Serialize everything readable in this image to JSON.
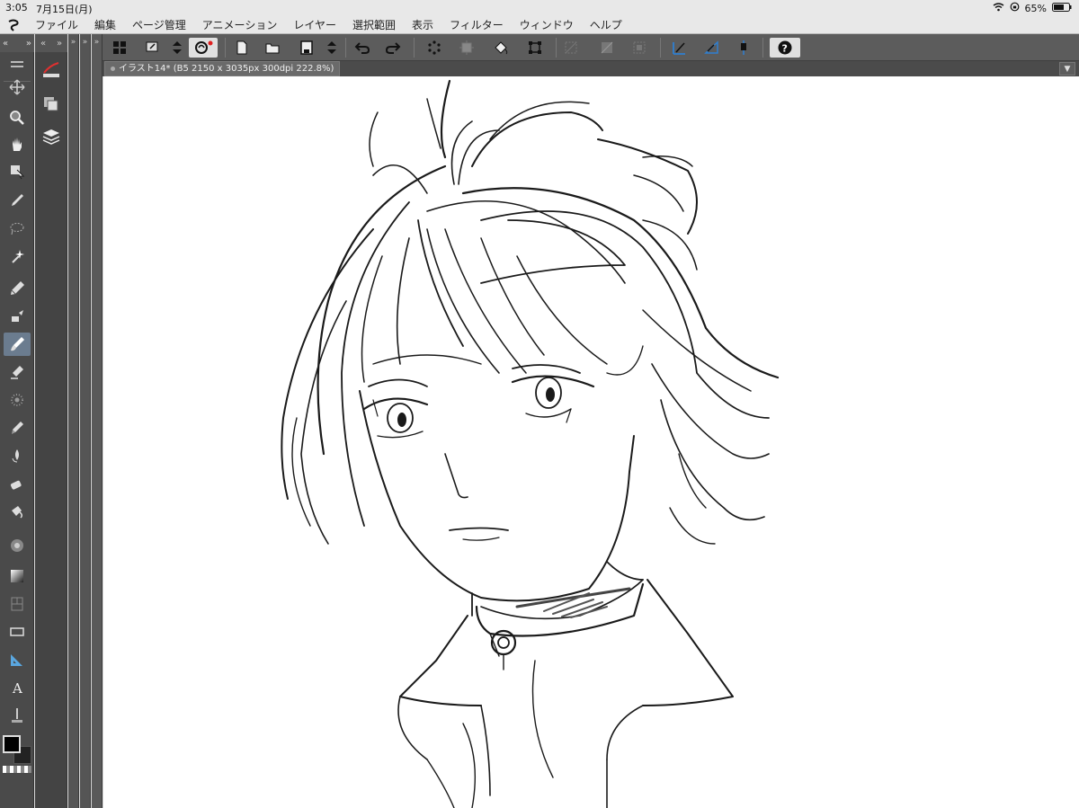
{
  "status": {
    "time": "3:05",
    "date": "7月15日(月)",
    "battery": "65%"
  },
  "menu": {
    "items": [
      "ファイル",
      "編集",
      "ページ管理",
      "アニメーション",
      "レイヤー",
      "選択範囲",
      "表示",
      "フィルター",
      "ウィンドウ",
      "ヘルプ"
    ]
  },
  "document": {
    "tab_title": "イラスト14* (B5 2150 x 3035px 300dpi 222.8%)"
  },
  "tools": [
    "move-icon",
    "zoom-icon",
    "hand-icon",
    "operation-icon",
    "eyedropper-icon",
    "lasso-icon",
    "magic-wand-icon",
    "pen-icon",
    "pencil-icon",
    "brush-icon",
    "airbrush-icon",
    "decoration-icon",
    "blend-icon",
    "eraser-icon",
    "fill-icon",
    "figure-icon",
    "gradient-icon",
    "frame-icon",
    "rectangle-icon",
    "ruler-icon",
    "text-icon",
    "correct-line-icon"
  ],
  "colors": {
    "main": "#000000",
    "sub": "#222222",
    "accent": "#6b7c8f"
  }
}
